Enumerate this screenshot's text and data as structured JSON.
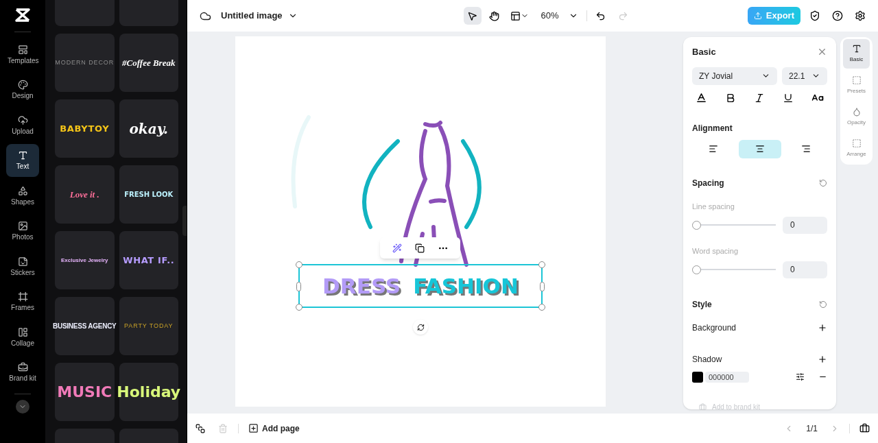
{
  "rail": {
    "items": [
      {
        "label": "Templates",
        "selected": false
      },
      {
        "label": "Design",
        "selected": false
      },
      {
        "label": "Upload",
        "selected": false
      },
      {
        "label": "Text",
        "selected": true
      },
      {
        "label": "Shapes",
        "selected": false
      },
      {
        "label": "Photos",
        "selected": false
      },
      {
        "label": "Stickers",
        "selected": false
      },
      {
        "label": "Frames",
        "selected": false
      },
      {
        "label": "Collage",
        "selected": false
      },
      {
        "label": "Brand kit",
        "selected": false
      }
    ]
  },
  "text_presets": [
    {
      "label": "MODERN DECOR",
      "color": "#8b8b8b",
      "kind": "thin"
    },
    {
      "label": "#Coffee Break",
      "color": "#ffffff",
      "kind": "serif"
    },
    {
      "label": "BABYTOY",
      "color": "#f5c518",
      "kind": "block"
    },
    {
      "label": "okay.",
      "color": "#ffffff",
      "kind": "italic"
    },
    {
      "label": "Love it .",
      "color": "#ff6f9a",
      "kind": "serif"
    },
    {
      "label": "FRESH LOOK",
      "color": "#bdf3ff",
      "kind": "narrow"
    },
    {
      "label": "Exclusive Jewelry",
      "color": "#e9b6ff",
      "kind": "small"
    },
    {
      "label": "WHAT IF..",
      "color": "#b69cff",
      "kind": "block"
    },
    {
      "label": "BUSINESS AGENCY",
      "color": "#eef0ff",
      "kind": "condensed"
    },
    {
      "label": "PARTY TODAY",
      "color": "#c9a227",
      "kind": "thin"
    },
    {
      "label": "MUSIC",
      "color": "#f07ab8",
      "kind": "big"
    },
    {
      "label": "Holiday",
      "color": "#d8f77a",
      "kind": "big"
    }
  ],
  "header": {
    "title": "Untitled image",
    "tools": [
      {
        "kind": "pointer",
        "selected": true
      },
      {
        "kind": "hand",
        "selected": false
      }
    ],
    "zoom": "60%",
    "export": "Export"
  },
  "canvas": {
    "headline": [
      {
        "text": "DRESS",
        "color": "#b39bf7"
      },
      {
        "text": "FASHION",
        "color": "#17c6d8"
      }
    ]
  },
  "panel": {
    "title": "Basic",
    "font": "ZY Jovial",
    "size": "22.1",
    "alignment": {
      "title": "Alignment",
      "options": [
        {
          "kind": "left",
          "selected": false
        },
        {
          "kind": "center",
          "selected": true
        },
        {
          "kind": "right",
          "selected": false
        }
      ]
    },
    "spacing": {
      "title": "Spacing",
      "sliders": [
        {
          "label": "Line spacing",
          "level": 0,
          "value": "0"
        },
        {
          "label": "Word spacing",
          "level": 0,
          "value": "0"
        }
      ]
    },
    "style": {
      "title": "Style",
      "background": "Background"
    },
    "shadow": {
      "title": "Shadow",
      "color": "#000000",
      "hex": "000000"
    },
    "brand": "Add to brand kit"
  },
  "side_tabs": [
    {
      "label": "Basic",
      "selected": true
    },
    {
      "label": "Presets",
      "selected": false
    },
    {
      "label": "Opacity",
      "selected": false
    },
    {
      "label": "Arrange",
      "selected": false
    }
  ],
  "footer": {
    "add_page": "Add page",
    "page": "1/1"
  }
}
